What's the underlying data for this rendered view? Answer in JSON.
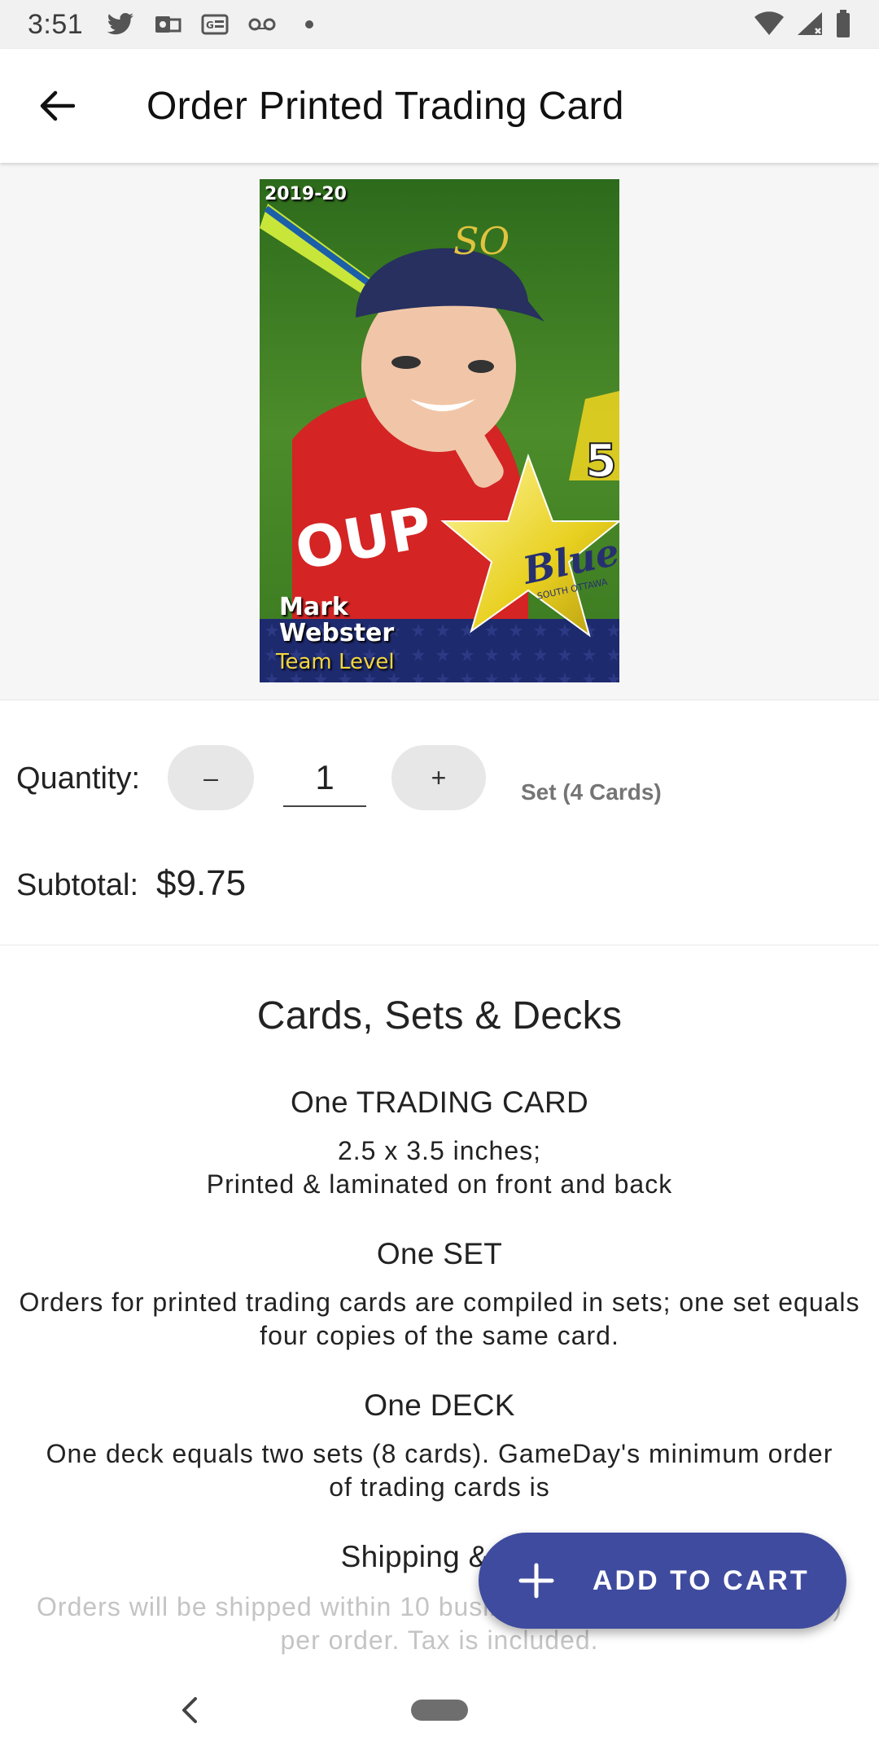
{
  "status_bar": {
    "time": "3:51",
    "left_icons": [
      "twitter-icon",
      "outlook-icon",
      "news-icon",
      "voicemail-icon",
      "dot-icon"
    ],
    "right_icons": [
      "wifi-icon",
      "cell-signal-icon",
      "battery-icon"
    ]
  },
  "app_bar": {
    "title": "Order Printed Trading Card",
    "back_icon": "arrow-back-icon"
  },
  "card": {
    "season": "2019-20",
    "first_name": "Mark",
    "last_name": "Webster",
    "level": "Team Level",
    "number": "5",
    "team_logo": "Blues",
    "team_subtitle": "SOUTH OTTAWA",
    "cap_letters": "SO",
    "jersey_text": "OUP"
  },
  "order": {
    "quantity_label": "Quantity:",
    "minus_label": "–",
    "quantity_value": "1",
    "plus_label": "+",
    "unit_label": "Set (4 Cards)",
    "subtotal_label": "Subtotal:",
    "subtotal_value": "$9.75"
  },
  "info": {
    "heading": "Cards, Sets & Decks",
    "card_title": "One TRADING CARD",
    "card_line1": "2.5 x 3.5 inches;",
    "card_line2": "Printed & laminated on front and back",
    "set_title": "One SET",
    "set_text": "Orders for printed trading cards are compiled in sets; one set equals four copies of the same card.",
    "deck_title": "One DECK",
    "deck_text": "One deck equals two sets (8 cards). GameDay's minimum order of trading cards is",
    "shipping_title": "Shipping & tax",
    "shipping_text": "Orders will be shipped within 10 business days. Shipping fee ($5) per order. Tax is included."
  },
  "fab": {
    "label": "ADD TO CART",
    "icon": "plus-icon"
  },
  "colors": {
    "accent": "#3f4b9e",
    "status_bar_bg": "#f1f1f1",
    "preview_bg": "#f6f6f6"
  }
}
